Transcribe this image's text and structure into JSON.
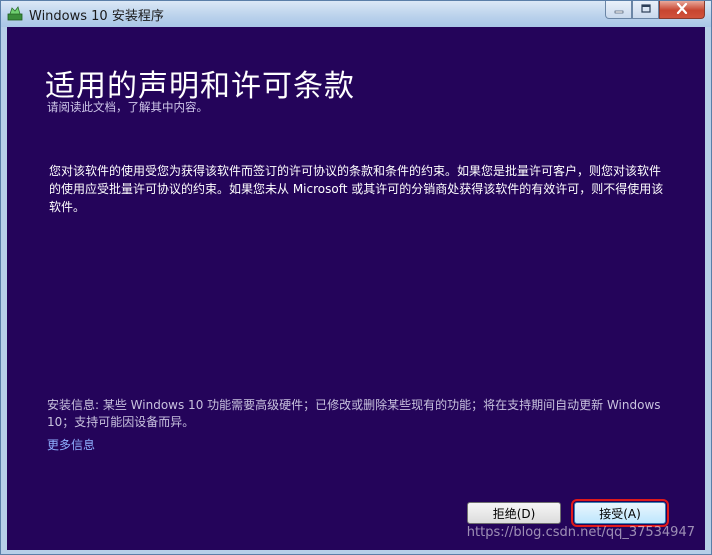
{
  "window": {
    "title": "Windows 10 安装程序",
    "icon": "setup-icon"
  },
  "caption_buttons": {
    "minimize": "minimize-icon",
    "maximize": "maximize-icon",
    "close": "close-icon"
  },
  "main": {
    "heading": "适用的声明和许可条款",
    "subheading": "请阅读此文档，了解其中内容。",
    "terms_text": "您对该软件的使用受您为获得该软件而签订的许可协议的条款和条件的约束。如果您是批量许可客户，则您对该软件的使用应受批量许可协议的约束。如果您未从 Microsoft 或其许可的分销商处获得该软件的有效许可，则不得使用该软件。",
    "install_info": "安装信息: 某些 Windows 10 功能需要高级硬件；已修改或删除某些现有的功能；将在支持期间自动更新 Windows 10；支持可能因设备而异。",
    "more_info_link": "更多信息"
  },
  "buttons": {
    "decline": "拒绝(D)",
    "accept": "接受(A)"
  },
  "watermark": "https://blog.csdn.net/qq_37534947",
  "colors": {
    "content_background": "#24045a",
    "titlebar": "#bcd3ec",
    "highlight_border": "#e01a1a",
    "link": "#8fb0ff"
  }
}
